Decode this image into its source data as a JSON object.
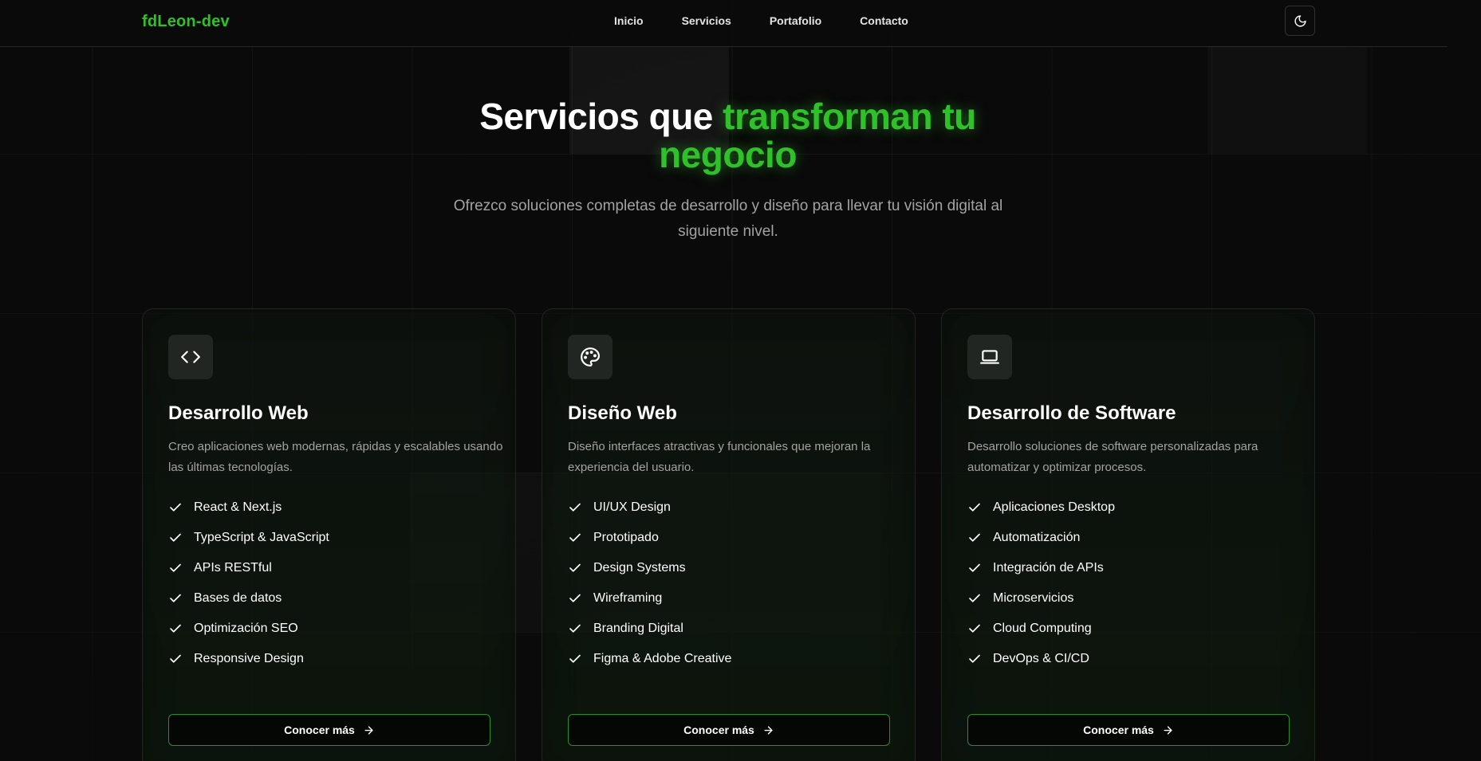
{
  "header": {
    "logo": "fdLeon-dev",
    "nav": [
      {
        "label": "Inicio"
      },
      {
        "label": "Servicios"
      },
      {
        "label": "Portafolio"
      },
      {
        "label": "Contacto"
      }
    ],
    "theme_toggle_icon": "moon-icon"
  },
  "hero": {
    "title_plain": "Servicios que ",
    "title_accent_line1": "transforman tu",
    "title_accent_line2": "negocio",
    "subtitle": "Ofrezco soluciones completas de desarrollo y diseño para llevar tu visión digital al siguiente nivel."
  },
  "colors": {
    "accent": "#2fc12a",
    "background": "#0a0a0a",
    "muted_text": "#a3a3a3",
    "button_border": "#2a8d27"
  },
  "services": [
    {
      "icon": "code-icon",
      "title": "Desarrollo Web",
      "description": "Creo aplicaciones web modernas, rápidas y escalables usando las últimas tecnologías.",
      "features": [
        "React & Next.js",
        "TypeScript & JavaScript",
        "APIs RESTful",
        "Bases de datos",
        "Optimización SEO",
        "Responsive Design"
      ],
      "button": "Conocer más"
    },
    {
      "icon": "palette-icon",
      "title": "Diseño Web",
      "description": "Diseño interfaces atractivas y funcionales que mejoran la experiencia del usuario.",
      "features": [
        "UI/UX Design",
        "Prototipado",
        "Design Systems",
        "Wireframing",
        "Branding Digital",
        "Figma & Adobe Creative"
      ],
      "button": "Conocer más"
    },
    {
      "icon": "laptop-icon",
      "title": "Desarrollo de Software",
      "description": "Desarrollo soluciones de software personalizadas para automatizar y optimizar procesos.",
      "features": [
        "Aplicaciones Desktop",
        "Automatización",
        "Integración de APIs",
        "Microservicios",
        "Cloud Computing",
        "DevOps & CI/CD"
      ],
      "button": "Conocer más"
    }
  ]
}
